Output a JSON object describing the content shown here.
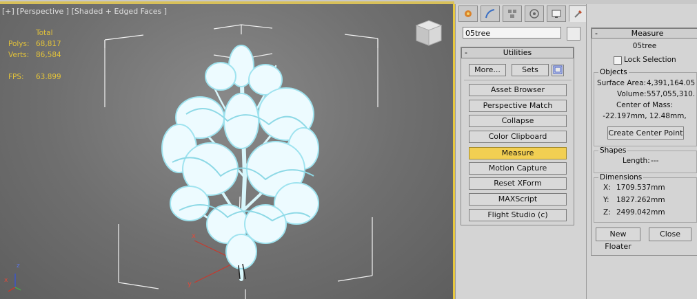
{
  "viewport": {
    "label": "[+] [Perspective ] [Shaded + Edged Faces ]",
    "stats": {
      "header": "Total",
      "polys_label": "Polys:",
      "polys": "68,817",
      "verts_label": "Verts:",
      "verts": "86,584",
      "fps_label": "FPS:",
      "fps": "63.899"
    },
    "gizmo_labels": {
      "x": "x",
      "y": "y",
      "z": "z"
    },
    "axis_triad": {
      "x": "x",
      "z": "z"
    }
  },
  "command_panel": {
    "tabs": [
      "create-icon",
      "modify-icon",
      "hierarchy-icon",
      "motion-icon",
      "display-icon",
      "utilities-icon"
    ],
    "object_name": "05tree",
    "utilities": {
      "title": "Utilities",
      "more_label": "More...",
      "sets_label": "Sets",
      "items": [
        "Asset Browser",
        "Perspective Match",
        "Collapse",
        "Color Clipboard",
        "Measure",
        "Motion Capture",
        "Reset XForm",
        "MAXScript",
        "Flight Studio (c)"
      ],
      "active_item": "Measure"
    }
  },
  "measure": {
    "title": "Measure",
    "object_name": "05tree",
    "lock_selection_label": "Lock Selection",
    "objects_group": "Objects",
    "surface_area_label": "Surface Area:",
    "surface_area": "4,391,164.05",
    "volume_label": "Volume:",
    "volume": "557,055,310.",
    "center_of_mass_label": "Center of Mass:",
    "center_of_mass": "-22.197mm, 12.48mm,",
    "create_center_point_label": "Create Center Point",
    "shapes_group": "Shapes",
    "length_label": "Length:",
    "length": "---",
    "dimensions_group": "Dimensions",
    "dim_x_label": "X:",
    "dim_x": "1709.537mm",
    "dim_y_label": "Y:",
    "dim_y": "1827.262mm",
    "dim_z_label": "Z:",
    "dim_z": "2499.042mm",
    "new_floater_label": "New Floater",
    "close_label": "Close"
  }
}
